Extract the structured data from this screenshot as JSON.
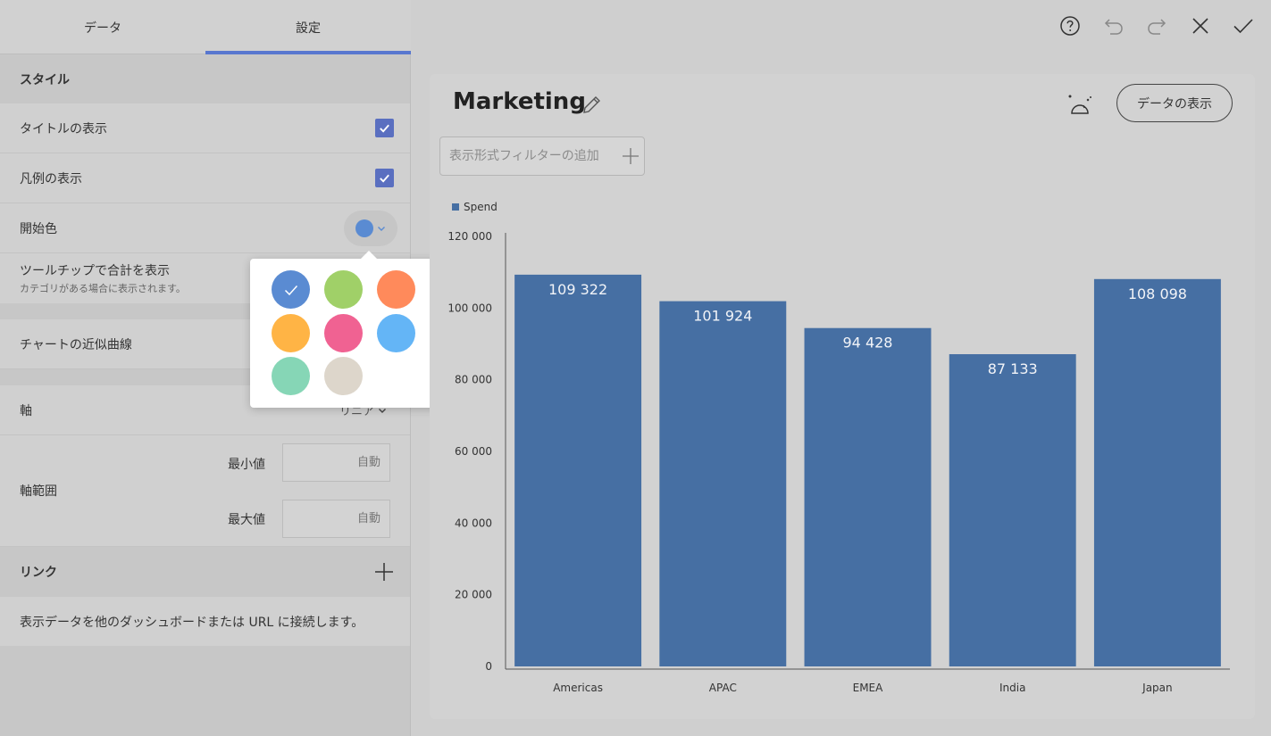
{
  "tabs": [
    {
      "label": "データ",
      "active": false
    },
    {
      "label": "設定",
      "active": true
    }
  ],
  "settings": {
    "style_header": "スタイル",
    "show_title": {
      "label": "タイトルの表示",
      "checked": true
    },
    "show_legend": {
      "label": "凡例の表示",
      "checked": true
    },
    "start_color": {
      "label": "開始色",
      "color": "#5a8bd2"
    },
    "tooltip_total": {
      "label": "ツールチップで合計を表示",
      "sublabel": "カテゴリがある場合に表示されます。"
    },
    "trendline": {
      "label": "チャートの近似曲線"
    },
    "axis": {
      "label": "軸",
      "value": "リニア"
    },
    "axis_range": {
      "label": "軸範囲",
      "min_label": "最小値",
      "min_placeholder": "自動",
      "max_label": "最大値",
      "max_placeholder": "自動"
    },
    "links_header": "リンク",
    "links_desc": "表示データを他のダッシュボードまたは URL に接続します。"
  },
  "color_picker": {
    "selected_index": 0,
    "swatches": [
      "#5a8bd2",
      "#a0d068",
      "#ff8a5b",
      "#ab87e8",
      "#ffb445",
      "#f06292",
      "#64b5f6",
      "#a1887f",
      "#86d6b6",
      "#ddd6cb"
    ]
  },
  "toolbar": {
    "icons": [
      "help-icon",
      "undo-icon",
      "redo-icon",
      "close-icon",
      "check-icon"
    ]
  },
  "card": {
    "title": "Marketing",
    "view_data_label": "データの表示",
    "filter_placeholder": "表示形式フィルターの追加"
  },
  "chart_data": {
    "type": "bar",
    "categories": [
      "Americas",
      "APAC",
      "EMEA",
      "India",
      "Japan"
    ],
    "series": [
      {
        "name": "Spend",
        "values": [
          109322,
          101924,
          94428,
          87133,
          108098
        ],
        "labels": [
          "109 322",
          "101 924",
          "94 428",
          "87 133",
          "108 098"
        ],
        "color": "#466fa3"
      }
    ],
    "ylim": [
      0,
      120000
    ],
    "yticks": [
      0,
      20000,
      40000,
      60000,
      80000,
      100000,
      120000
    ],
    "ytick_labels": [
      "0",
      "20 000",
      "40 000",
      "60 000",
      "80 000",
      "100 000",
      "120 000"
    ],
    "legend": "top-left",
    "grid": false
  }
}
